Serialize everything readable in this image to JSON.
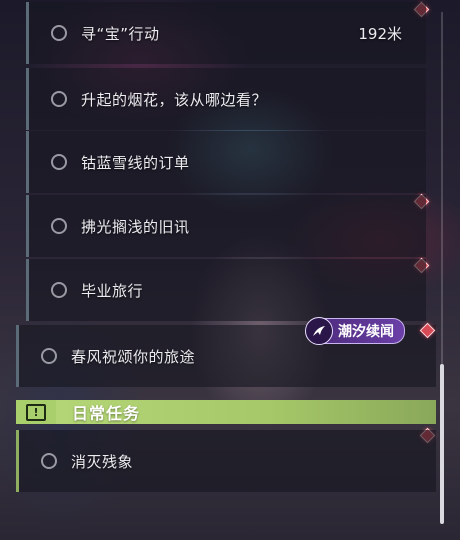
{
  "quests": [
    {
      "label": "寻“宝”行动",
      "distance": "192米"
    },
    {
      "label": "升起的烟花，该从哪边看？"
    },
    {
      "label": "钴蓝雪线的订单"
    },
    {
      "label": "拂光搁浅的旧讯"
    },
    {
      "label": "毕业旅行"
    },
    {
      "label": "春风祝颂你的旅途"
    }
  ],
  "event_tag": {
    "label": "潮汐续闻"
  },
  "daily": {
    "header": "日常任务",
    "badge_glyph": "!",
    "quests": [
      {
        "label": "消灭残象"
      }
    ]
  },
  "colors": {
    "daily_accent": "#b6d878",
    "marker_red": "#d94a57",
    "tag_purple": "#6b3fa8"
  }
}
